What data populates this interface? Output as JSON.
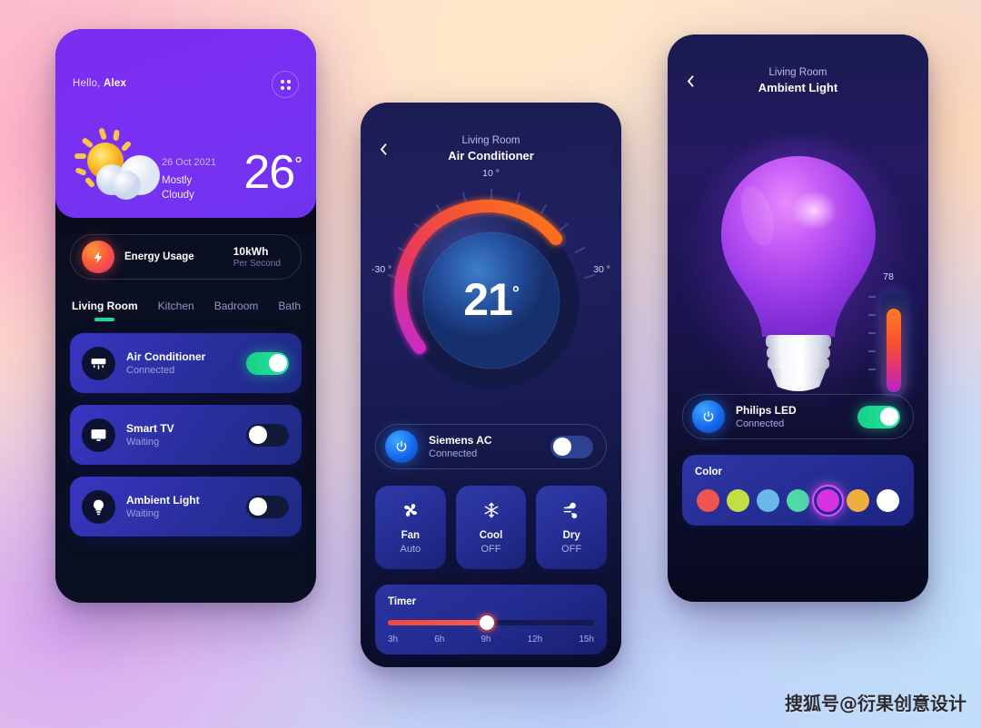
{
  "screen1": {
    "greeting_prefix": "Hello, ",
    "user_name": "Alex",
    "grid_icon": "grid-dots-icon",
    "weather": {
      "date": "26 Oct 2021",
      "condition_line1": "Mostly",
      "condition_line2": "Cloudy",
      "temperature": "26",
      "degree": "°",
      "icon": "sun-behind-cloud-icon"
    },
    "energy": {
      "label": "Energy Usage",
      "value": "10kWh",
      "sub": "Per Second",
      "icon": "lightning-bolt-icon"
    },
    "tabs": [
      {
        "label": "Living Room",
        "active": true
      },
      {
        "label": "Kitchen",
        "active": false
      },
      {
        "label": "Badroom",
        "active": false
      },
      {
        "label": "Bath",
        "active": false
      }
    ],
    "devices": [
      {
        "name": "Air Conditioner",
        "state": "Connected",
        "icon": "air-conditioner-icon",
        "on": true
      },
      {
        "name": "Smart TV",
        "state": "Waiting",
        "icon": "monitor-icon",
        "on": false
      },
      {
        "name": "Ambient Light",
        "state": "Waiting",
        "icon": "lightbulb-icon",
        "on": false
      }
    ]
  },
  "screen2": {
    "back_icon": "chevron-left-icon",
    "room": "Living Room",
    "device": "Air Conditioner",
    "dial": {
      "value": "21",
      "degree": "°",
      "label_top": "10 °",
      "label_left": "-30 °",
      "label_right": "30 °"
    },
    "power": {
      "name": "Siemens AC",
      "state": "Connected",
      "icon": "power-icon",
      "on": false
    },
    "modes": [
      {
        "name": "Fan",
        "value": "Auto",
        "icon": "fan-icon"
      },
      {
        "name": "Cool",
        "value": "OFF",
        "icon": "snowflake-icon"
      },
      {
        "name": "Dry",
        "value": "OFF",
        "icon": "wind-icon"
      }
    ],
    "timer": {
      "title": "Timer",
      "ticks": [
        "3h",
        "6h",
        "9h",
        "12h",
        "15h"
      ],
      "thumb_label": "9h"
    }
  },
  "screen3": {
    "back_icon": "chevron-left-icon",
    "room": "Living Room",
    "device": "Ambient Light",
    "bulb_icon": "lightbulb-3d-icon",
    "brightness": {
      "value": "78"
    },
    "power": {
      "name": "Philips LED",
      "state": "Connected",
      "icon": "power-icon",
      "on": true
    },
    "color": {
      "title": "Color",
      "swatches": [
        {
          "name": "red",
          "hex": "#ef5550",
          "selected": false
        },
        {
          "name": "yellow-green",
          "hex": "#c3de42",
          "selected": false
        },
        {
          "name": "light-blue",
          "hex": "#69b9e8",
          "selected": false
        },
        {
          "name": "mint",
          "hex": "#4fd9a6",
          "selected": false
        },
        {
          "name": "magenta",
          "hex": "#d632e0",
          "selected": true
        },
        {
          "name": "orange",
          "hex": "#f0ae42",
          "selected": false
        },
        {
          "name": "white",
          "hex": "#ffffff",
          "selected": false
        }
      ]
    }
  },
  "watermark": "搜狐号@衍果创意设计"
}
